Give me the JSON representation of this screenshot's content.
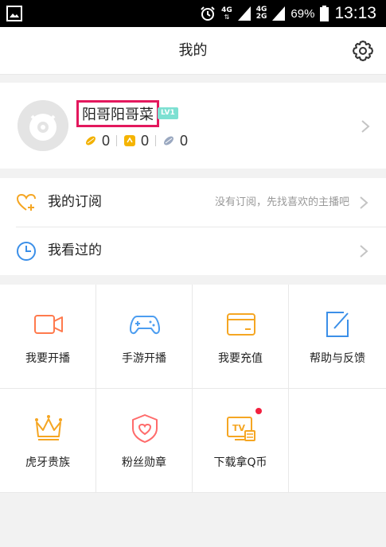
{
  "status_bar": {
    "network_1": "4G",
    "network_2": "4G",
    "network_3": "2G",
    "battery": "69%",
    "time": "13:13"
  },
  "header": {
    "title": "我的",
    "settings_icon": "gear-icon"
  },
  "profile": {
    "username": "阳哥阳哥菜",
    "level": "LV1",
    "stats": [
      {
        "icon": "bean-icon",
        "value": "0",
        "color": "#f2a900"
      },
      {
        "icon": "coin-icon",
        "value": "0",
        "color": "#f5b400"
      },
      {
        "icon": "silver-bean-icon",
        "value": "0",
        "color": "#9aa8c0"
      }
    ]
  },
  "list": [
    {
      "icon": "heart-plus-icon",
      "label": "我的订阅",
      "hint": "没有订阅，先找喜欢的主播吧",
      "color": "#f5a623"
    },
    {
      "icon": "clock-icon",
      "label": "我看过的",
      "hint": "",
      "color": "#3b8fe8"
    }
  ],
  "grid": [
    {
      "icon": "video-camera-icon",
      "label": "我要开播",
      "color": "#ff7a4d"
    },
    {
      "icon": "gamepad-icon",
      "label": "手游开播",
      "color": "#4c9df0"
    },
    {
      "icon": "wallet-card-icon",
      "label": "我要充值",
      "color": "#f5a623"
    },
    {
      "icon": "edit-icon",
      "label": "帮助与反馈",
      "color": "#3b8fe8"
    },
    {
      "icon": "crown-icon",
      "label": "虎牙贵族",
      "color": "#f5a623"
    },
    {
      "icon": "heart-shield-icon",
      "label": "粉丝勋章",
      "color": "#ff6b6b"
    },
    {
      "icon": "tv-coin-icon",
      "label": "下载拿Q币",
      "color": "#f5a623",
      "badge": "red-dot"
    }
  ]
}
